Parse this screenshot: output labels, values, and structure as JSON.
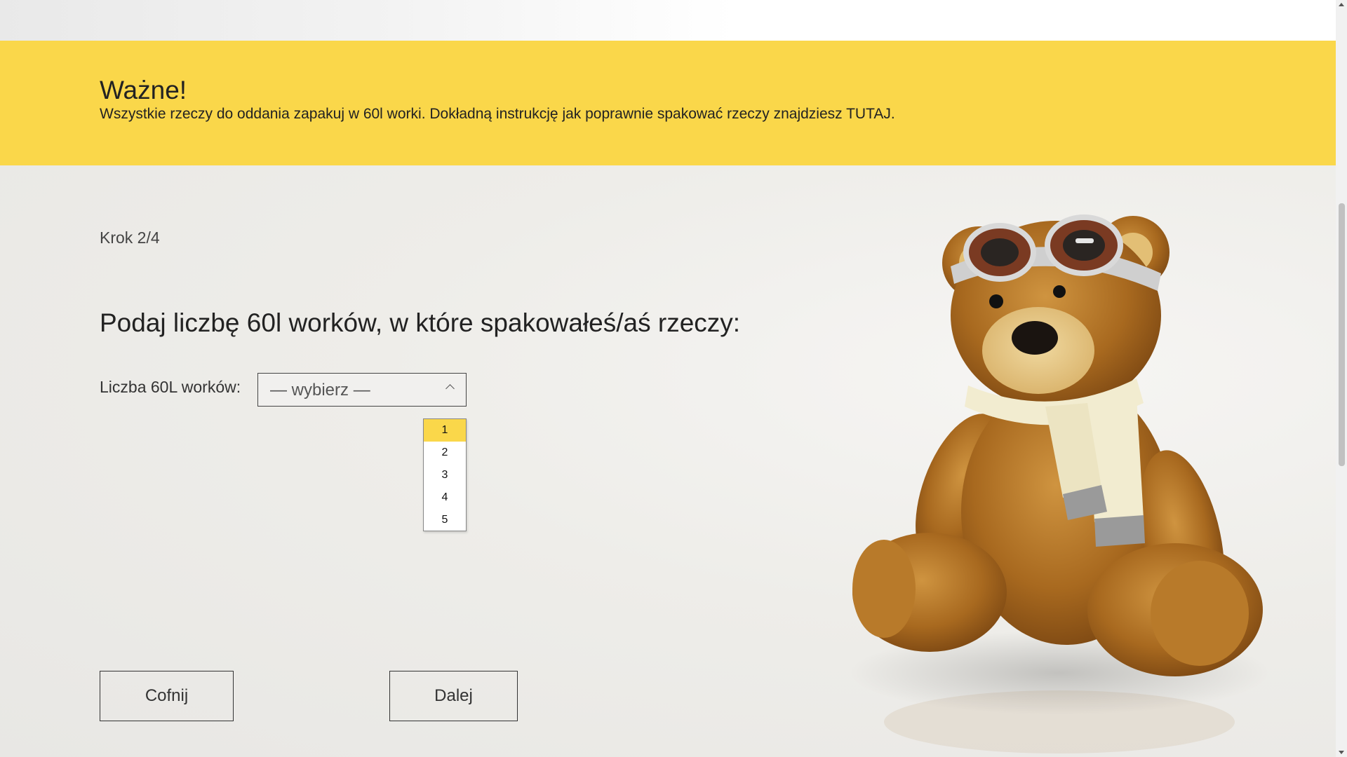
{
  "notice": {
    "title": "Ważne!",
    "text": "Wszystkie rzeczy do oddania zapakuj w 60l worki. Dokładną instrukcję jak poprawnie spakować rzeczy znajdziesz TUTAJ."
  },
  "form": {
    "step": "Krok 2/4",
    "question": "Podaj liczbę 60l worków, w które spakowałeś/aś rzeczy:",
    "field_label": "Liczba 60L worków:",
    "select_value": "— wybierz —",
    "options": [
      "1",
      "2",
      "3",
      "4",
      "5"
    ],
    "highlighted_option": "1"
  },
  "buttons": {
    "back": "Cofnij",
    "next": "Dalej"
  },
  "colors": {
    "accent": "#fad74a",
    "background": "#ecebe9",
    "text": "#222222"
  },
  "icons": {
    "select_chevron": "chevron-up-icon",
    "illustration": "teddy-bear-aviator-image"
  }
}
